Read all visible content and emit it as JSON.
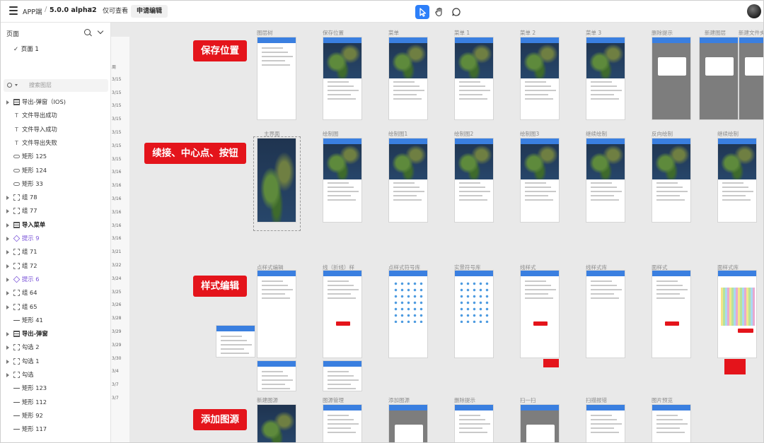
{
  "topbar": {
    "project": "APP端",
    "separator": "/",
    "version": "5.0.0 alpha2",
    "mode_view": "仅可查看",
    "mode_edit": "申请编辑",
    "colors": {
      "accent": "#2d7ff9"
    }
  },
  "left_panel": {
    "title": "页面",
    "page": "页面 1",
    "search_placeholder": "搜索图层",
    "layers": [
      {
        "label": "导出-弹窗（IOS)",
        "icon": "component-icon",
        "arrow": true,
        "style": ""
      },
      {
        "label": "文件导出成功",
        "icon": "text-icon",
        "arrow": false,
        "style": ""
      },
      {
        "label": "文件导入成功",
        "icon": "text-icon",
        "arrow": false,
        "style": ""
      },
      {
        "label": "文件导出失败",
        "icon": "text-icon",
        "arrow": false,
        "style": ""
      },
      {
        "label": "矩形 125",
        "icon": "rect-icon",
        "arrow": false,
        "style": ""
      },
      {
        "label": "矩形 124",
        "icon": "rect-icon",
        "arrow": false,
        "style": ""
      },
      {
        "label": "矩形 33",
        "icon": "rect-icon",
        "arrow": false,
        "style": ""
      },
      {
        "label": "组 78",
        "icon": "group-icon",
        "arrow": true,
        "style": ""
      },
      {
        "label": "组 77",
        "icon": "group-icon",
        "arrow": true,
        "style": ""
      },
      {
        "label": "导入菜单",
        "icon": "component-icon",
        "arrow": true,
        "style": "bold"
      },
      {
        "label": "提示 9",
        "icon": "diamond-icon",
        "arrow": true,
        "style": "purple"
      },
      {
        "label": "组 71",
        "icon": "group-icon",
        "arrow": true,
        "style": ""
      },
      {
        "label": "组 72",
        "icon": "group-icon",
        "arrow": true,
        "style": ""
      },
      {
        "label": "提示 6",
        "icon": "diamond-icon",
        "arrow": true,
        "style": "purple"
      },
      {
        "label": "组 64",
        "icon": "group-icon",
        "arrow": true,
        "style": ""
      },
      {
        "label": "组 65",
        "icon": "group-icon",
        "arrow": true,
        "style": ""
      },
      {
        "label": "矩形 41",
        "icon": "line-icon",
        "arrow": false,
        "style": ""
      },
      {
        "label": "导出-弹窗",
        "icon": "component-icon",
        "arrow": true,
        "style": "bold"
      },
      {
        "label": "勾选 2",
        "icon": "group-icon",
        "arrow": true,
        "style": ""
      },
      {
        "label": "勾选 1",
        "icon": "group-icon",
        "arrow": true,
        "style": ""
      },
      {
        "label": "勾选",
        "icon": "group-icon",
        "arrow": true,
        "style": ""
      },
      {
        "label": "矩形 123",
        "icon": "line-icon",
        "arrow": false,
        "style": ""
      },
      {
        "label": "矩形 112",
        "icon": "line-icon",
        "arrow": false,
        "style": ""
      },
      {
        "label": "矩形 92",
        "icon": "line-icon",
        "arrow": false,
        "style": ""
      },
      {
        "label": "矩形 117",
        "icon": "line-icon",
        "arrow": false,
        "style": ""
      }
    ]
  },
  "ruler": [
    "周",
    "3/15",
    "3/15",
    "3/15",
    "3/15",
    "3/15",
    "3/15",
    "3/15",
    "3/16",
    "3/16",
    "3/16",
    "3/16",
    "3/16",
    "3/16",
    "3/21",
    "3/22",
    "3/24",
    "3/25",
    "3/26",
    "3/28",
    "3/29",
    "3/29",
    "3/30",
    "3/4",
    "3/7",
    "3/7"
  ],
  "sections": {
    "save_position": "保存位置",
    "continue_center_button": "续接、中心点、按钮",
    "style_edit": "样式编辑",
    "add_layer_source": "添加图源"
  },
  "row1_labels": [
    "图层树",
    "保存位置",
    "菜单",
    "菜单 1",
    "菜单 2",
    "菜单 3",
    "删除提示",
    "新建图层",
    "新建文件夹"
  ],
  "row2_labels": [
    "主界面",
    "绘制图",
    "绘制图1",
    "绘制图2",
    "绘制图3",
    "继续绘制",
    "反向绘制",
    "继续绘制"
  ],
  "row3_labels": [
    "点样式编辑",
    "线（折线）样",
    "点样式符号库",
    "实景符号库",
    "线样式",
    "线样式库",
    "面样式",
    "面样式库"
  ],
  "row4_labels": [
    "新建图源",
    "图源管理",
    "添加图源",
    "删除提示",
    "扫一扫",
    "扫描报错",
    "图片预览"
  ]
}
